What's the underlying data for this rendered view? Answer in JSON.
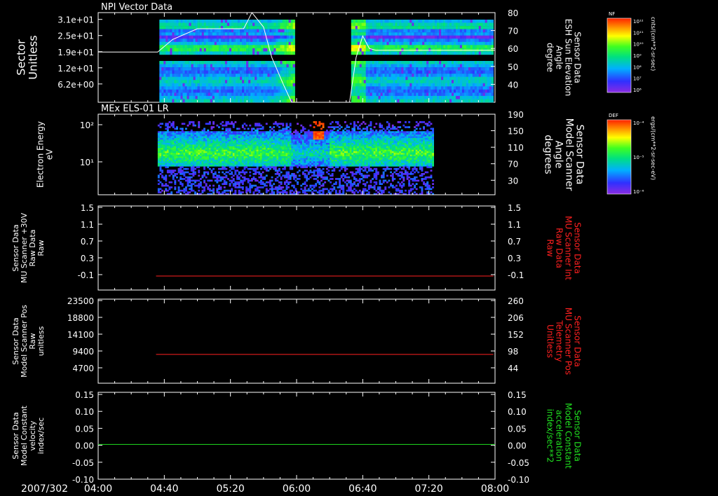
{
  "time_axis": {
    "date_label": "2007/302",
    "ticks": [
      "04:00",
      "04:40",
      "05:20",
      "06:00",
      "06:40",
      "07:20",
      "08:00"
    ]
  },
  "panels": [
    {
      "id": "npi",
      "title": "NPI Vector Data",
      "left_label": [
        "Sector",
        "Unitless"
      ],
      "right_label": [
        "Sensor Data",
        "ESH Sun Elevation",
        "Angle",
        "degree"
      ],
      "right_label_color": "#ffffff",
      "left_ticks": [
        "3.1e+01",
        "2.5e+01",
        "1.9e+01",
        "1.2e+01",
        "6.2e+00"
      ],
      "right_ticks": [
        "80",
        "70",
        "60",
        "50",
        "40"
      ]
    },
    {
      "id": "els",
      "title": "MEx ELS-01 LR",
      "left_label": [
        "Electron Energy",
        "eV"
      ],
      "right_label": [
        "Sensor Data",
        "Model Scanner",
        "Angle",
        "degrees"
      ],
      "right_label_color": "#ffffff",
      "left_ticks": [
        "10²",
        "10¹"
      ],
      "right_ticks": [
        "190",
        "150",
        "110",
        "70",
        "30"
      ]
    },
    {
      "id": "mu30v",
      "title": "",
      "left_label": [
        "Sensor Data",
        "MU Scanner +30V",
        "Raw Data",
        "Raw"
      ],
      "right_label": [
        "Sensor Data",
        "MU Scanner Int",
        "Raw Data",
        "Raw"
      ],
      "right_label_color": "#ff2020",
      "left_ticks": [
        "1.5",
        "1.1",
        "0.7",
        "0.3",
        "-0.1"
      ],
      "right_ticks": [
        "1.5",
        "1.1",
        "0.7",
        "0.3",
        "-0.1"
      ]
    },
    {
      "id": "mupos",
      "title": "",
      "left_label": [
        "Sensor Data",
        "Model Scanner Pos",
        "Raw",
        "unitless"
      ],
      "right_label": [
        "Sensor Data",
        "MU Scanner Pos",
        "Telemetry",
        "Unitless"
      ],
      "right_label_color": "#ff2020",
      "left_ticks": [
        "23500",
        "18800",
        "14100",
        "9400",
        "4700"
      ],
      "right_ticks": [
        "260",
        "206",
        "152",
        "98",
        "44"
      ]
    },
    {
      "id": "model",
      "title": "",
      "left_label": [
        "Sensor Data",
        "Model Constant",
        "velocity",
        "index/sec"
      ],
      "right_label": [
        "Sensor Data",
        "Model Constant",
        "acceleration",
        "index/sec**2"
      ],
      "right_label_color": "#20e020",
      "left_ticks": [
        "0.15",
        "0.10",
        "0.05",
        "0.00",
        "-0.05",
        "-0.10"
      ],
      "right_ticks": [
        "0.15",
        "0.10",
        "0.05",
        "0.00",
        "-0.05",
        "-0.10"
      ]
    }
  ],
  "colorbars": [
    {
      "tag": "NF",
      "label": "cnts/(cm**2-sr-sec)",
      "ticks": [
        "10¹²",
        "10¹¹",
        "10¹⁰",
        "10⁹",
        "10⁸",
        "10⁷",
        "10⁶"
      ]
    },
    {
      "tag": "DEF",
      "label": "ergs/(cm**2-sr-sec-eV)",
      "ticks": [
        "10⁻⁴",
        "10⁻⁵",
        "10⁻⁶"
      ]
    }
  ],
  "chart_data": [
    {
      "type": "heatmap",
      "title": "NPI Vector Data",
      "ylabel": "Sector Unitless",
      "y2label": "Sensor Data ESH Sun Elevation Angle degree",
      "x_range": [
        "04:00",
        "08:00"
      ],
      "y2lim": [
        30,
        80
      ],
      "data_intervals": [
        [
          "04:37",
          "05:59"
        ],
        [
          "06:33",
          "07:59"
        ]
      ],
      "sun_elevation": {
        "x": [
          "04:00",
          "04:36",
          "04:45",
          "05:00",
          "05:28",
          "05:33",
          "05:40",
          "05:45",
          "05:52",
          "05:57",
          "06:32",
          "06:36",
          "06:40",
          "06:44",
          "06:48",
          "08:00"
        ],
        "y": [
          58,
          58,
          65,
          71,
          71,
          80,
          72,
          55,
          40,
          30,
          30,
          55,
          67,
          60,
          59,
          59
        ]
      }
    },
    {
      "type": "heatmap",
      "title": "MEx ELS-01 LR",
      "ylabel": "Electron Energy eV",
      "y2label": "Sensor Data Model Scanner Angle degrees",
      "x_range": [
        "04:00",
        "08:00"
      ],
      "ylog": true,
      "y2lim": [
        10,
        190
      ],
      "data_intervals": [
        [
          "04:36",
          "07:23"
        ]
      ],
      "scanner_angle": {
        "x": [
          "04:00",
          "08:00"
        ],
        "y": [
          10,
          10
        ]
      }
    },
    {
      "type": "line",
      "ylabel": "Sensor Data MU Scanner +30V Raw Data Raw",
      "y2label": "Sensor Data MU Scanner Int Raw Data Raw",
      "ylim": [
        -0.3,
        1.5
      ],
      "series": [
        {
          "name": "Sensor Data MU Scanner Int Raw Data Raw",
          "color": "#ff2020",
          "x": [
            "04:35",
            "07:59"
          ],
          "y": [
            0.0,
            0.0
          ]
        }
      ]
    },
    {
      "type": "line",
      "ylabel": "Sensor Data Model Scanner Pos Raw unitless",
      "y2label": "Sensor Data MU Scanner Pos Telemetry Unitless",
      "ylim": [
        0,
        23500
      ],
      "y2lim": [
        0,
        260
      ],
      "series": [
        {
          "name": "Sensor Data MU Scanner Pos Telemetry Unitless",
          "color": "#ff2020",
          "x": [
            "04:35",
            "07:59"
          ],
          "y": [
            89,
            89
          ]
        }
      ]
    },
    {
      "type": "line",
      "ylabel": "Sensor Data Model Constant velocity index/sec",
      "y2label": "Sensor Data Model Constant acceleration index/sec**2",
      "ylim": [
        -0.1,
        0.15
      ],
      "series": [
        {
          "name": "Sensor Data Model Constant acceleration index/sec**2",
          "color": "#20e020",
          "x": [
            "04:00",
            "08:00"
          ],
          "y": [
            0.0,
            0.0
          ]
        }
      ]
    }
  ]
}
